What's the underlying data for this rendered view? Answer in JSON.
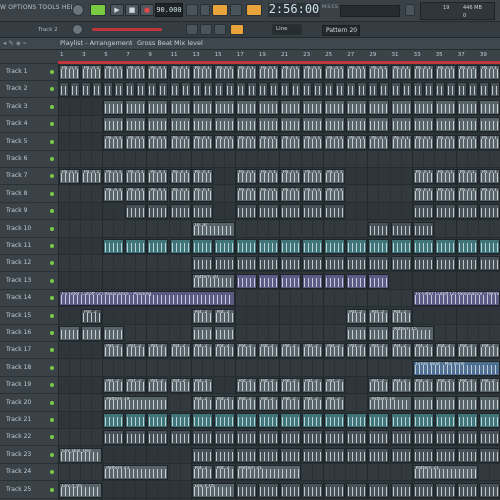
{
  "menu": {
    "text": "W  OPTIONS  TOOLS  HELP"
  },
  "transport": {
    "tempo": "90.000",
    "time": "2:56:00",
    "time_label": "M:S:CS",
    "snap": "Line",
    "pattern": "Pattern 20",
    "cpu": "19",
    "mem": "446 MB",
    "voices": "0"
  },
  "hint": {
    "track_label": "Track 2"
  },
  "playlist": {
    "title": "Playlist - Arrangement",
    "crumbs": [
      "Gross Beat",
      "Mix level"
    ]
  },
  "ruler": {
    "bars": [
      "1",
      "3",
      "5",
      "7",
      "9",
      "11",
      "13",
      "15",
      "17",
      "19",
      "21",
      "23",
      "25",
      "27",
      "29",
      "31",
      "33",
      "35",
      "37",
      "39"
    ]
  },
  "tracks": [
    "Track 1",
    "Track 2",
    "Track 3",
    "Track 4",
    "Track 5",
    "Track 6",
    "Track 7",
    "Track 8",
    "Track 9",
    "Track 10",
    "Track 11",
    "Track 12",
    "Track 13",
    "Track 14",
    "Track 15",
    "Track 16",
    "Track 17",
    "Track 18",
    "Track 19",
    "Track 20",
    "Track 21",
    "Track 22",
    "Track 23",
    "Track 24",
    "Track 25"
  ],
  "clip_labels": {
    "pa": "Pa..n 1",
    "pat2": "Pat..2",
    "le": "Le..ar",
    "p20": "Pattern 20",
    "fx14": "Fx Filter Cutoff (Z) Resonance - Panning",
    "p15": "Pattern 15",
    "gb": "Gross Beat - Mix level",
    "p19": "Pattern 19",
    "p21": "Pattern 21",
    "lev": "Lev_Bus_Dec",
    "lev2": "Lev..t_05"
  },
  "colors": {
    "accent_red": "#c0363d",
    "clip_gray": "#59636a",
    "clip_purple": "#5d5a86",
    "clip_teal": "#3f7579"
  }
}
